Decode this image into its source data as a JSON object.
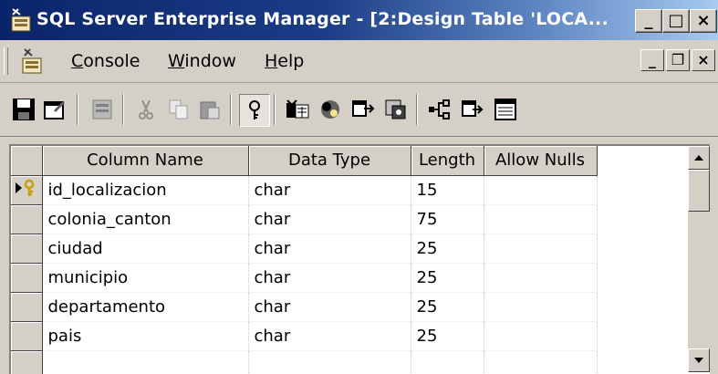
{
  "window": {
    "title": "SQL Server Enterprise Manager - [2:Design Table 'LOCA...",
    "controls": {
      "minimize": "_",
      "maximize": "□",
      "close": "×"
    }
  },
  "menu": {
    "items": [
      {
        "accel": "C",
        "rest": "onsole"
      },
      {
        "accel": "W",
        "rest": "indow"
      },
      {
        "accel": "H",
        "rest": "elp"
      }
    ],
    "mdi_controls": {
      "minimize": "_",
      "restore": "❐",
      "close": "×"
    }
  },
  "toolbar": {
    "buttons": [
      "save-icon",
      "properties-icon",
      "insert-column-icon",
      "cut-icon",
      "copy-icon",
      "paste-icon",
      "primary-key-icon",
      "manage-indexes-icon",
      "manage-relationships-icon",
      "manage-constraints-icon",
      "manage-triggers-icon",
      "dependencies-icon",
      "generate-script-icon",
      "grid-view-icon"
    ]
  },
  "grid": {
    "headers": [
      "Column Name",
      "Data Type",
      "Length",
      "Allow Nulls"
    ],
    "rows": [
      {
        "name": "id_localizacion",
        "type": "char",
        "length": "15",
        "primary_key": true
      },
      {
        "name": "colonia_canton",
        "type": "char",
        "length": "75"
      },
      {
        "name": "ciudad",
        "type": "char",
        "length": "25"
      },
      {
        "name": "municipio",
        "type": "char",
        "length": "25"
      },
      {
        "name": "departamento",
        "type": "char",
        "length": "25"
      },
      {
        "name": "pais",
        "type": "char",
        "length": "25"
      }
    ]
  },
  "colors": {
    "titlebar_start": "#0a246a",
    "titlebar_end": "#a6caf0",
    "chrome": "#d4d0c8",
    "key_icon": "#c8a000"
  }
}
